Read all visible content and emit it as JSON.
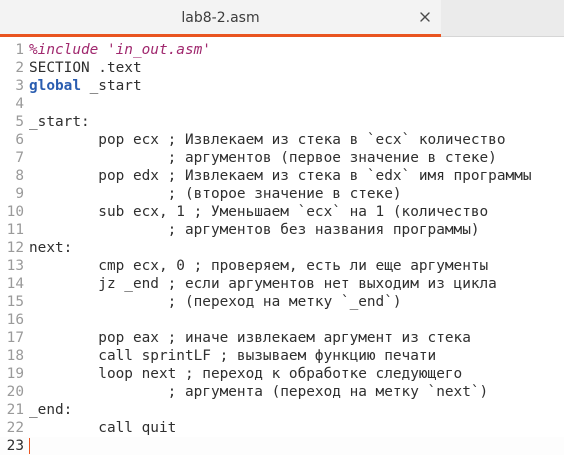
{
  "tab": {
    "title": "lab8-2.asm",
    "close_icon": "close-icon"
  },
  "editor": {
    "current_line": 23,
    "lines": [
      {
        "n": "1",
        "parts": [
          {
            "t": "%include ",
            "c": "directive"
          },
          {
            "t": "'in_out.asm'",
            "c": "string"
          }
        ]
      },
      {
        "n": "2",
        "parts": [
          {
            "t": "SECTION .text",
            "c": "plain"
          }
        ]
      },
      {
        "n": "3",
        "parts": [
          {
            "t": "global",
            "c": "keyword"
          },
          {
            "t": " _start",
            "c": "plain"
          }
        ]
      },
      {
        "n": "4",
        "parts": []
      },
      {
        "n": "5",
        "parts": [
          {
            "t": "_start:",
            "c": "plain"
          }
        ]
      },
      {
        "n": "6",
        "parts": [
          {
            "t": "        pop ecx ; Извлекаем из стека в `ecx` количество",
            "c": "plain"
          }
        ]
      },
      {
        "n": "7",
        "parts": [
          {
            "t": "                ; аргументов (первое значение в стеке)",
            "c": "plain"
          }
        ]
      },
      {
        "n": "8",
        "parts": [
          {
            "t": "        pop edx ; Извлекаем из стека в `edx` имя программы",
            "c": "plain"
          }
        ]
      },
      {
        "n": "9",
        "parts": [
          {
            "t": "                ; (второе значение в стеке)",
            "c": "plain"
          }
        ]
      },
      {
        "n": "10",
        "parts": [
          {
            "t": "        sub ecx, 1 ; Уменьшаем `ecx` на 1 (количество",
            "c": "plain"
          }
        ]
      },
      {
        "n": "11",
        "parts": [
          {
            "t": "                ; аргументов без названия программы)",
            "c": "plain"
          }
        ]
      },
      {
        "n": "12",
        "parts": [
          {
            "t": "next:",
            "c": "plain"
          }
        ]
      },
      {
        "n": "13",
        "parts": [
          {
            "t": "        cmp ecx, 0 ; проверяем, есть ли еще аргументы",
            "c": "plain"
          }
        ]
      },
      {
        "n": "14",
        "parts": [
          {
            "t": "        jz _end ; если аргументов нет выходим из цикла",
            "c": "plain"
          }
        ]
      },
      {
        "n": "15",
        "parts": [
          {
            "t": "                ; (переход на метку `_end`)",
            "c": "plain"
          }
        ]
      },
      {
        "n": "16",
        "parts": []
      },
      {
        "n": "17",
        "parts": [
          {
            "t": "        pop eax ; иначе извлекаем аргумент из стека",
            "c": "plain"
          }
        ]
      },
      {
        "n": "18",
        "parts": [
          {
            "t": "        call sprintLF ; вызываем функцию печати",
            "c": "plain"
          }
        ]
      },
      {
        "n": "19",
        "parts": [
          {
            "t": "        loop next ; переход к обработке следующего",
            "c": "plain"
          }
        ]
      },
      {
        "n": "20",
        "parts": [
          {
            "t": "                ; аргумента (переход на метку `next`)",
            "c": "plain"
          }
        ]
      },
      {
        "n": "21",
        "parts": [
          {
            "t": "_end:",
            "c": "plain"
          }
        ]
      },
      {
        "n": "22",
        "parts": [
          {
            "t": "        call quit",
            "c": "plain"
          }
        ]
      },
      {
        "n": "23",
        "parts": []
      }
    ]
  }
}
